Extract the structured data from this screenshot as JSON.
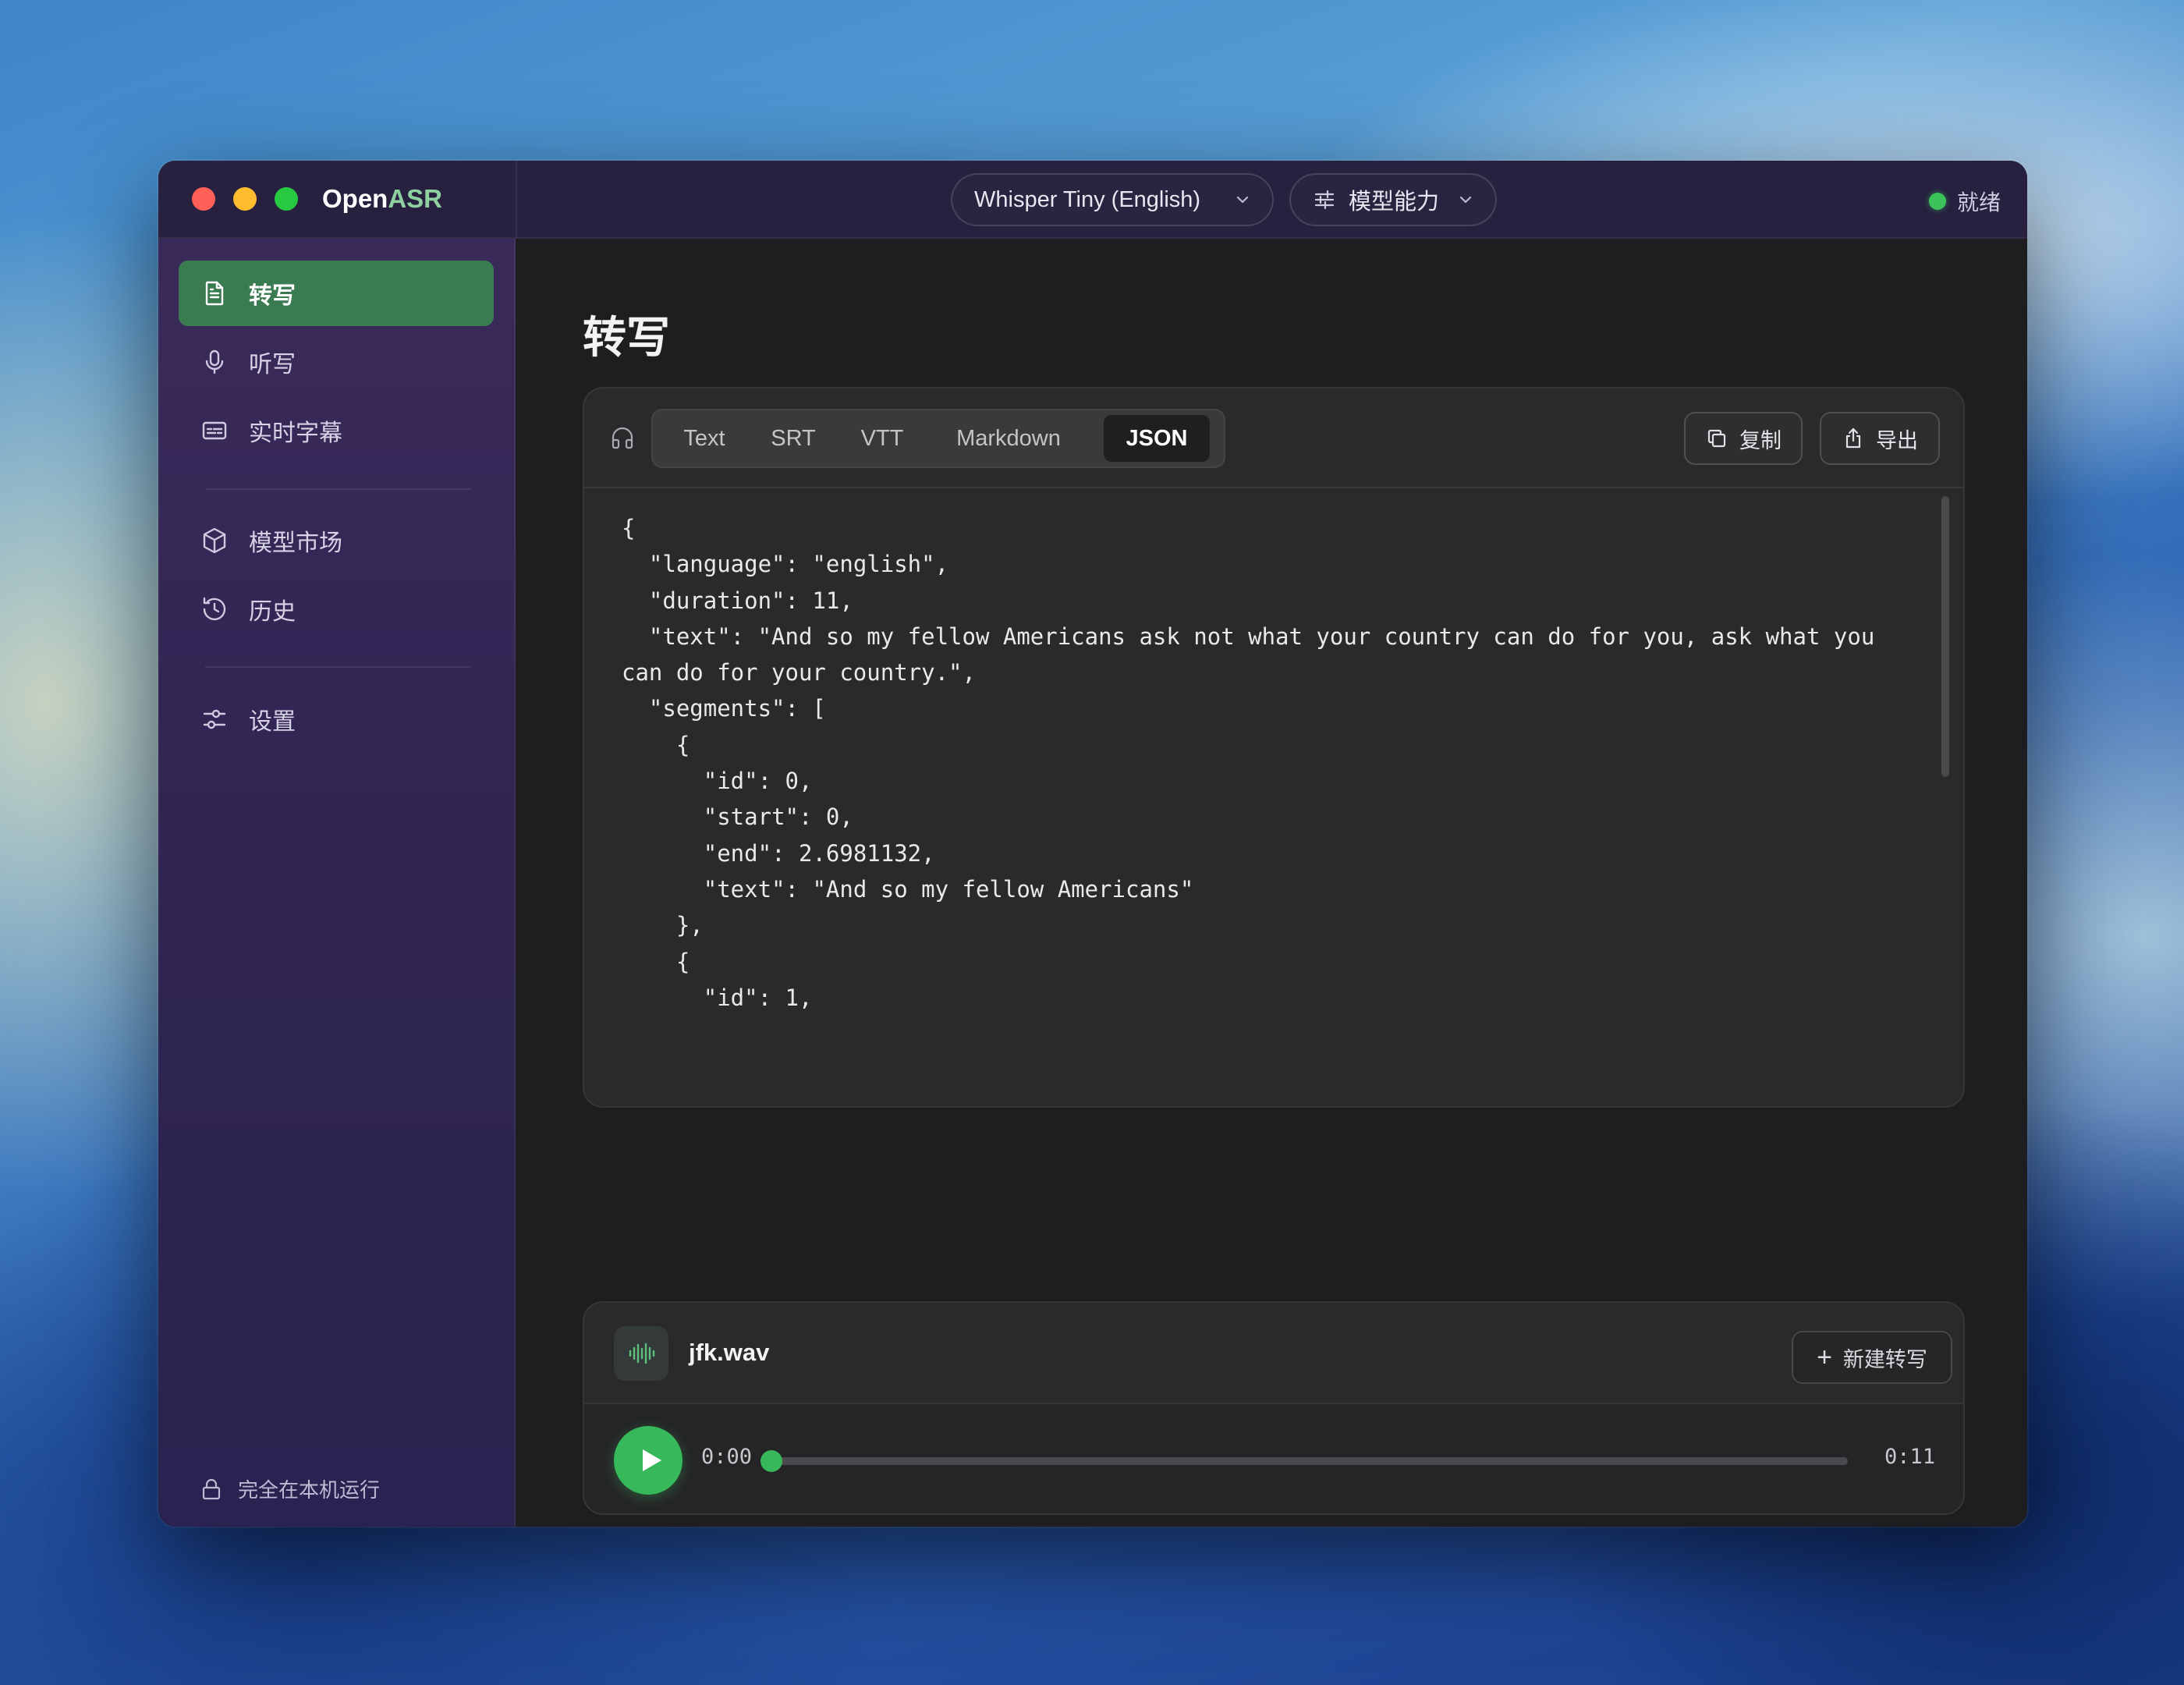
{
  "app": {
    "name_main": "Open",
    "name_accent": "ASR"
  },
  "titlebar": {
    "model_selector": "Whisper Tiny (English)",
    "capability_selector": "模型能力",
    "status": "就绪",
    "status_color": "#3cc35c"
  },
  "sidebar": {
    "items": [
      {
        "label": "转写",
        "icon": "document-icon",
        "active": true
      },
      {
        "label": "听写",
        "icon": "microphone-icon",
        "active": false
      },
      {
        "label": "实时字幕",
        "icon": "captions-icon",
        "active": false
      },
      {
        "label": "模型市场",
        "icon": "cube-icon",
        "active": false
      },
      {
        "label": "历史",
        "icon": "history-icon",
        "active": false
      },
      {
        "label": "设置",
        "icon": "settings-sliders-icon",
        "active": false
      }
    ],
    "footer": "完全在本机运行"
  },
  "main": {
    "title": "转写",
    "format_tabs": [
      "Text",
      "SRT",
      "VTT",
      "Markdown",
      "JSON"
    ],
    "active_tab": "JSON",
    "copy_label": "复制",
    "export_label": "导出",
    "output": "{\n  \"language\": \"english\",\n  \"duration\": 11,\n  \"text\": \"And so my fellow Americans ask not what your country can do for you, ask what you can do for your country.\",\n  \"segments\": [\n    {\n      \"id\": 0,\n      \"start\": 0,\n      \"end\": 2.6981132,\n      \"text\": \"And so my fellow Americans\"\n    },\n    {\n      \"id\": 1,"
  },
  "audio": {
    "file_name": "jfk.wav",
    "current_time": "0:00",
    "total_time": "0:11",
    "progress": 0
  },
  "new_transcription_label": "新建转写",
  "colors": {
    "accent": "#37b85a",
    "sidebar_active": "#3b7b52"
  }
}
